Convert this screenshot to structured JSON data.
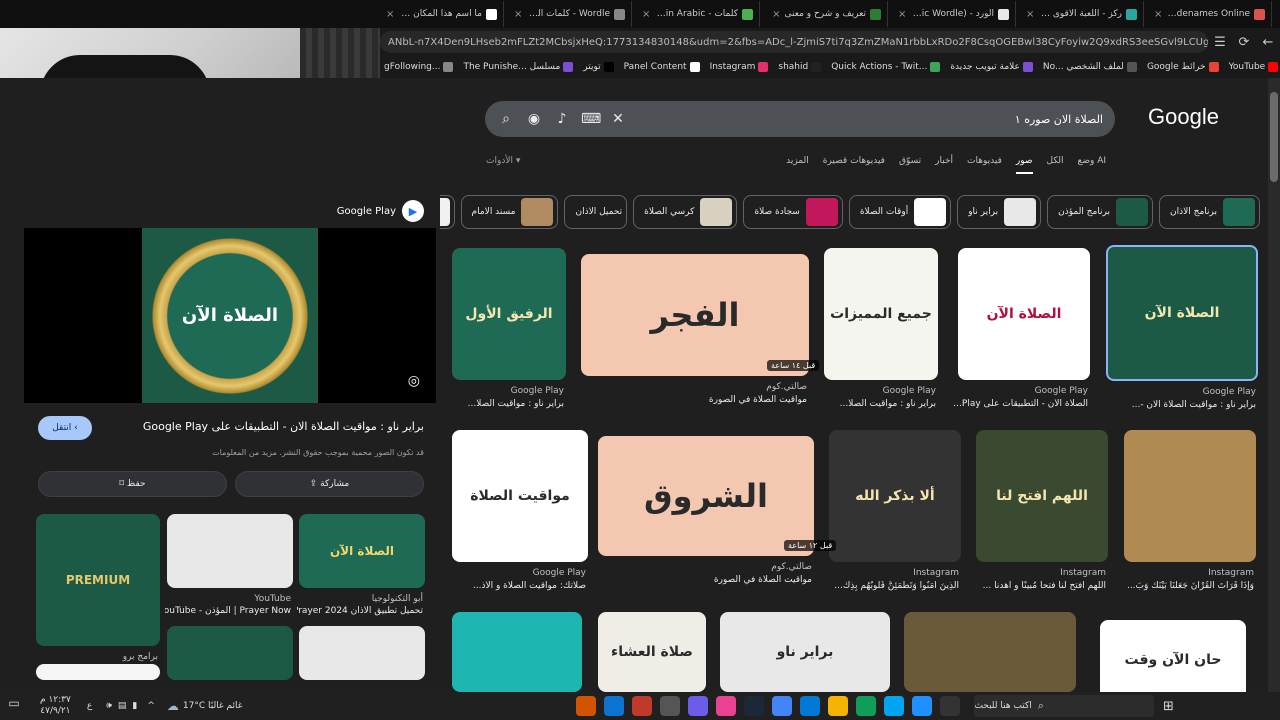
{
  "browser": {
    "tabs": [
      {
        "title": "Codenames Online",
        "color": "#d9534f"
      },
      {
        "title": "رکز - اللعبة الأقوى على",
        "color": "#2aa7a0"
      },
      {
        "title": "الورد - (Arabic Wordle)",
        "color": "#e9e9e9"
      },
      {
        "title": "تعريف و شرح و معنى",
        "color": "#2e7d32"
      },
      {
        "title": "كلمات - Wordle in Arabic",
        "color": "#4caf50"
      },
      {
        "title": "Wordle - كلمات اليومية",
        "color": "#888"
      },
      {
        "title": "ما اسم هذا المكان - ي",
        "color": "#fff"
      }
    ],
    "url": "ANbL-n7X4Den9LHseb2mFLZt2MCbsjxHeQ:1773134830148&udm=2&fbs=ADc_l-ZjmiS7ti7q3ZmZMaN1rbbLxRDo2F8CsqOGEBwl38CyFoyiw2Q9xdRS3eeSGvl9LCUg9Wuf8Nx9uMB85dkfvdNyxe...",
    "bookmarks": [
      {
        "label": "gFollowing...",
        "color": "#888"
      },
      {
        "label": "The Punishe... مسلسل",
        "color": "#7b4fd0"
      },
      {
        "label": "تويتر",
        "color": "#000"
      },
      {
        "label": "Panel Content",
        "color": "#fff"
      },
      {
        "label": "Instagram",
        "color": "#e1306c"
      },
      {
        "label": "shahid",
        "color": "#222"
      },
      {
        "label": "Quick Actions - Twit...",
        "color": "#3ba55c"
      },
      {
        "label": "علامة تبويب جديدة",
        "color": "#7b4fd0"
      },
      {
        "label": "No... لملف الشخصي",
        "color": "#555"
      },
      {
        "label": "Google خرائط",
        "color": "#ea4335"
      },
      {
        "label": "YouTube",
        "color": "#ff0000"
      },
      {
        "label": "Gmail",
        "color": "#ea4335"
      }
    ]
  },
  "google": {
    "logo": "Google",
    "query": "الصلاة الان صوره ١",
    "tabs": [
      "وضع AI",
      "الكل",
      "صور",
      "فيديوهات",
      "أخبار",
      "تسوّق",
      "فيديوهات قصيرة",
      "المزيد"
    ],
    "active_tab": "صور",
    "tools": "الأدوات",
    "chips": [
      {
        "label": "برنامج الاذان",
        "color": "#1e6a55"
      },
      {
        "label": "برنامج المؤذن",
        "color": "#1c5a46"
      },
      {
        "label": "براير ناو",
        "color": "#e8e8e8"
      },
      {
        "label": "أوقات الصلاة",
        "color": "#ffffff"
      },
      {
        "label": "سجادة صلاة",
        "color": "#c2185b"
      },
      {
        "label": "كرسي الصلاة",
        "color": "#d8d0c0"
      },
      {
        "label": "تحميل الاذان",
        "color": ""
      },
      {
        "label": "مسند الامام",
        "color": "#b08a60"
      },
      {
        "label": "",
        "color": "#f0f0f0"
      }
    ]
  },
  "preview": {
    "source": "Google Play",
    "image_text": "الصلاة الآن",
    "title": "براير ناو : مواقيت الصلاة الان - التطبيقات على Google Play",
    "visit": "انتقل",
    "note": "قد تكون الصور محمية بموجب حقوق النشر. مزيد من المعلومات",
    "share": "مشاركة",
    "save": "حفظ",
    "related": [
      {
        "title": "تحميل الاذان Prayer Now",
        "source": "برامج برو",
        "color": "#1c5a46",
        "label": "PREMIUM"
      },
      {
        "title": "Prayer Now | المؤذن - YouTube",
        "source": "YouTube",
        "color": "#e8e8e8",
        "label": ""
      },
      {
        "title": "تحميل تطبيق الآذان Prayer 2024",
        "source": "أبو التكنولوجيا",
        "color": "#1e6a55",
        "label": "الصلاة الآن"
      },
      {
        "title": "",
        "source": "",
        "color": "#1c5a46",
        "label": ""
      },
      {
        "title": "",
        "source": "",
        "color": "#e8e8e8",
        "label": ""
      },
      {
        "title": "",
        "source": "",
        "color": "#f5f5f5",
        "label": ""
      }
    ]
  },
  "results": [
    {
      "source": "Google Play",
      "title": "براير ناو : مواقيت الصلاة الان -...",
      "color": "#1c5a46",
      "text": "الصلاة الآن"
    },
    {
      "source": "Google Play",
      "title": "الصلاة الآن - التطبيقات على Play...",
      "color": "#ffffff",
      "text": "الصلاة الآن"
    },
    {
      "source": "Google Play",
      "title": "براير ناو : مواقيت الصلا...",
      "color": "#f5f5f0",
      "text": "جميع المميزات"
    },
    {
      "source": "صالتي.كوم",
      "title": "مواقيت الصلاة في الصورة",
      "color": "#f3c7b0",
      "text": "الفجر"
    },
    {
      "source": "Google Play",
      "title": "براير ناو : مواقيت الصلا...",
      "color": "#1e6a55",
      "text": "الرفيق الأول"
    },
    {
      "source": "Instagram",
      "title": "وَإِذَا قَرَأْتَ الْقُرْآنَ جَعَلْنَا بَيْنَكَ وَبَ...",
      "color": "#b08a50",
      "text": ""
    },
    {
      "source": "Instagram",
      "title": "اللهم افتح لنا فتحا مُبينًا و اهدنا ...",
      "color": "#3a4a30",
      "text": "اللهم افتح لنا"
    },
    {
      "source": "Instagram",
      "title": "الَّذِينَ آمَنُوا وَتَطْمَئِنُّ قُلُوبُهُم بِذِكْ...",
      "color": "#333333",
      "text": "ألا بذكر الله"
    },
    {
      "source": "صالتي.كوم",
      "title": "مواقيت الصلاة في الصورة",
      "color": "#f3c7b0",
      "text": "الشروق"
    },
    {
      "source": "Google Play",
      "title": "صلاتك: مواقيت الصلاة و الأذ...",
      "color": "#ffffff",
      "text": "مواقيت الصلاة"
    },
    {
      "source": "",
      "title": "",
      "color": "#ffffff",
      "text": "حان الآن وقت"
    },
    {
      "source": "",
      "title": "",
      "color": "#6b5a3a",
      "text": ""
    },
    {
      "source": "",
      "title": "",
      "color": "#e8e8e8",
      "text": "براير ناو"
    },
    {
      "source": "",
      "title": "",
      "color": "#f0ede6",
      "text": "صلاة العشاء"
    },
    {
      "source": "",
      "title": "",
      "color": "#1fb5b0",
      "text": ""
    }
  ],
  "time_badges": [
    "قبل ١٤ ساعة",
    "قبل ١٢ ساعة"
  ],
  "taskbar": {
    "search_placeholder": "اكتب هنا للبحث",
    "weather": "17°C غائم غالبًا",
    "time": "١٢:٣٧ م",
    "date": "٤٧/٩/٢١",
    "lang": "ع"
  }
}
